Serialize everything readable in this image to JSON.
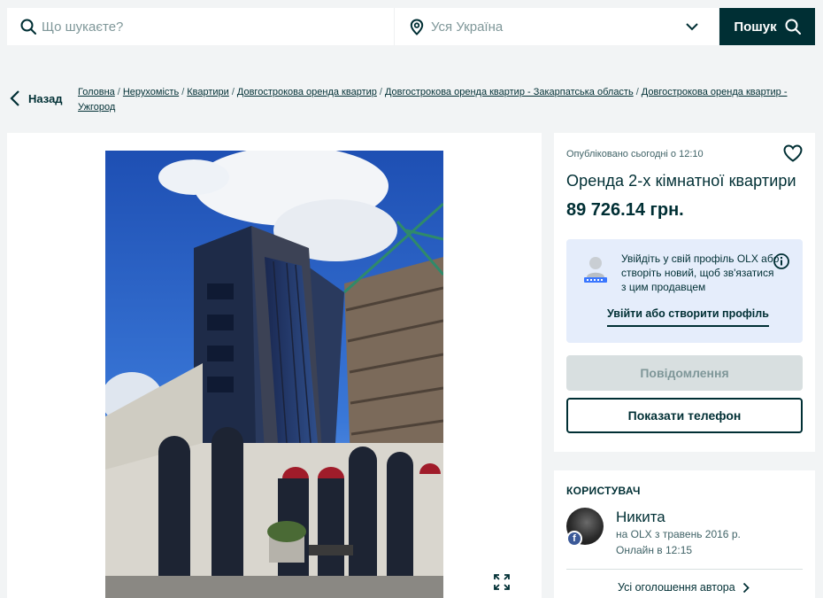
{
  "search": {
    "query_placeholder": "Що шукаєте?",
    "location_placeholder": "Уся Україна",
    "button_label": "Пошук"
  },
  "nav": {
    "back_label": "Назад",
    "breadcrumbs": [
      "Головна",
      "Нерухомість",
      "Квартири",
      "Довгострокова оренда квартир",
      "Довгострокова оренда квартир - Закарпатська область",
      "Довгострокова оренда квартир - Ужгород"
    ],
    "separator": "/"
  },
  "listing": {
    "posted": "Опубліковано сьогодні о 12:10",
    "title": "Оренда 2-х кімнатної квартири",
    "price": "89 726.14 грн.",
    "login_prompt": "Увійдіть у свій профіль OLX або створіть новий, щоб зв'язатися з цим продавцем",
    "login_link": "Увійти або створити профіль",
    "message_button": "Повідомлення",
    "phone_button": "Показати телефон"
  },
  "user": {
    "heading": "КОРИСТУВАЧ",
    "name": "Никита",
    "since": "на OLX з травень 2016 р.",
    "online": "Онлайн в 12:15",
    "all_ads": "Усі оголошення автора",
    "badge": "f"
  },
  "colors": {
    "primary": "#002f34",
    "background": "#f2f4f5",
    "login_box": "#e5edfb",
    "disabled_button": "#d8dfe0"
  }
}
